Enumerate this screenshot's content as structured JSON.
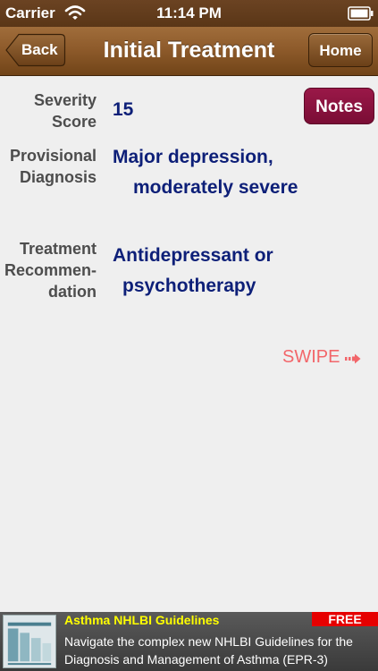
{
  "status_bar": {
    "carrier": "Carrier",
    "time": "11:14 PM"
  },
  "nav_bar": {
    "back_label": "Back",
    "title": "Initial Treatment",
    "home_label": "Home"
  },
  "content": {
    "severity_label": [
      "Severity",
      "Score"
    ],
    "severity_value": "15",
    "diagnosis_label": [
      "Provisional",
      "Diagnosis"
    ],
    "diagnosis_value": [
      "Major depression,",
      "moderately severe"
    ],
    "treatment_label": [
      "Treatment",
      "Recommen-",
      "dation"
    ],
    "treatment_value": [
      "Antidepressant or",
      "psychotherapy"
    ],
    "notes_label": "Notes",
    "swipe_hint": "SWIPE"
  },
  "ad": {
    "title": "Asthma NHLBI Guidelines",
    "badge": "FREE",
    "description": "Navigate the complex new NHLBI Guidelines for the Diagnosis and Management of Asthma (EPR-3)"
  },
  "colors": {
    "nav_brown": "#8e5b2b",
    "notes_maroon": "#8a1140",
    "value_navy": "#0d1f78",
    "swipe_pink": "#f2666a",
    "ad_yellow": "#ffff00",
    "ad_badge_red": "#e60000"
  }
}
